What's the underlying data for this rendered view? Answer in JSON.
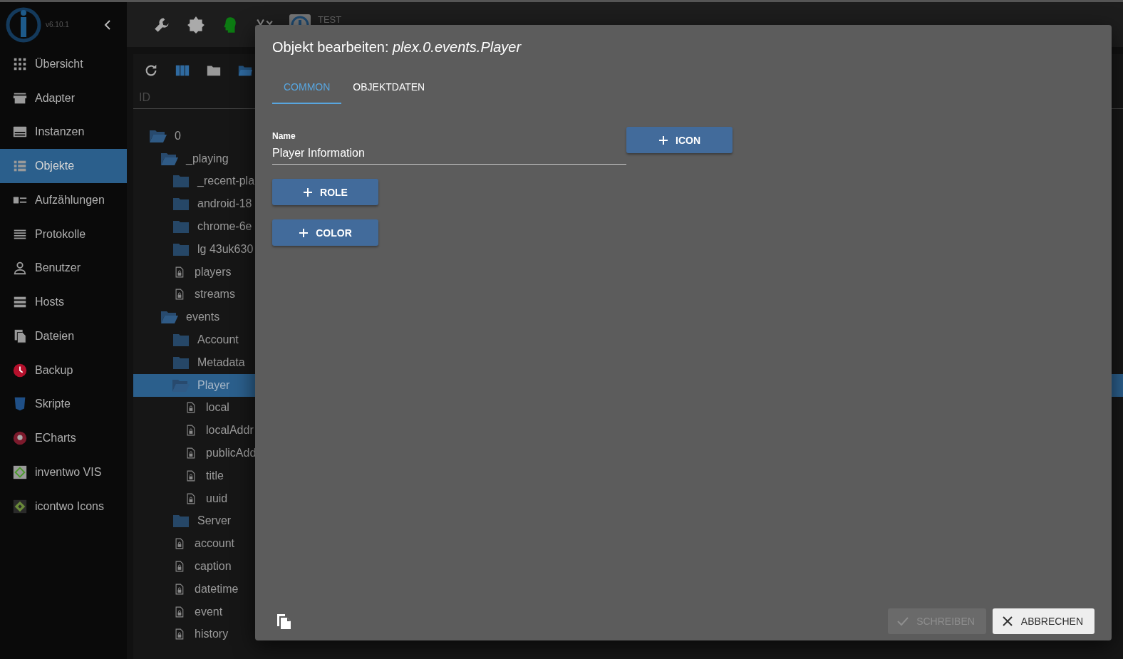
{
  "top_bar": {
    "host": "TEST"
  },
  "sidebar": {
    "version": "v6.10.1",
    "items": [
      {
        "label": "Übersicht",
        "selected": false
      },
      {
        "label": "Adapter",
        "selected": false
      },
      {
        "label": "Instanzen",
        "selected": false
      },
      {
        "label": "Objekte",
        "selected": true
      },
      {
        "label": "Aufzählungen",
        "selected": false
      },
      {
        "label": "Protokolle",
        "selected": false
      },
      {
        "label": "Benutzer",
        "selected": false
      },
      {
        "label": "Hosts",
        "selected": false
      },
      {
        "label": "Dateien",
        "selected": false
      },
      {
        "label": "Backup",
        "selected": false
      },
      {
        "label": "Skripte",
        "selected": false
      },
      {
        "label": "ECharts",
        "selected": false
      },
      {
        "label": "inventwo VIS",
        "selected": false
      },
      {
        "label": "icontwo Icons",
        "selected": false
      }
    ]
  },
  "objects": {
    "column": "ID",
    "tree": [
      {
        "label": "0",
        "kind": "folder-open",
        "selected": false,
        "children": [
          {
            "label": "_playing",
            "kind": "folder-open",
            "selected": false,
            "children": [
              {
                "label": "_recent-pla",
                "kind": "folder",
                "selected": false
              },
              {
                "label": "android-18",
                "kind": "folder",
                "selected": false
              },
              {
                "label": "chrome-6e",
                "kind": "folder",
                "selected": false
              },
              {
                "label": "lg 43uk630",
                "kind": "folder",
                "selected": false
              },
              {
                "label": "players",
                "kind": "file",
                "selected": false
              },
              {
                "label": "streams",
                "kind": "file",
                "selected": false
              }
            ]
          },
          {
            "label": "events",
            "kind": "folder-open",
            "selected": false,
            "children": [
              {
                "label": "Account",
                "kind": "folder",
                "selected": false
              },
              {
                "label": "Metadata",
                "kind": "folder",
                "selected": false
              },
              {
                "label": "Player",
                "kind": "folder-open",
                "selected": true,
                "children": [
                  {
                    "label": "local",
                    "kind": "file",
                    "selected": false
                  },
                  {
                    "label": "localAddr",
                    "kind": "file",
                    "selected": false
                  },
                  {
                    "label": "publicAdd",
                    "kind": "file",
                    "selected": false
                  },
                  {
                    "label": "title",
                    "kind": "file",
                    "selected": false
                  },
                  {
                    "label": "uuid",
                    "kind": "file",
                    "selected": false
                  }
                ]
              },
              {
                "label": "Server",
                "kind": "folder",
                "selected": false
              },
              {
                "label": "account",
                "kind": "file",
                "selected": false
              },
              {
                "label": "caption",
                "kind": "file",
                "selected": false
              },
              {
                "label": "datetime",
                "kind": "file",
                "selected": false
              },
              {
                "label": "event",
                "kind": "file",
                "selected": false
              },
              {
                "label": "history",
                "kind": "file",
                "selected": false
              }
            ]
          }
        ]
      }
    ]
  },
  "dialog": {
    "title": "Objekt bearbeiten: *plex.0.events.Player*",
    "tabs": [
      {
        "label": "COMMON",
        "selected": true
      },
      {
        "label": "OBJEKTDATEN",
        "selected": false
      }
    ],
    "name_field": {
      "label": "Name",
      "value": "Player Information"
    },
    "add_buttons": [
      "ICON",
      "ROLE",
      "COLOR"
    ],
    "footer": [
      {
        "label": "SCHREIBEN",
        "disabled": true,
        "kind": "check"
      },
      {
        "label": "ABBRECHEN",
        "disabled": false,
        "kind": "close"
      }
    ]
  }
}
